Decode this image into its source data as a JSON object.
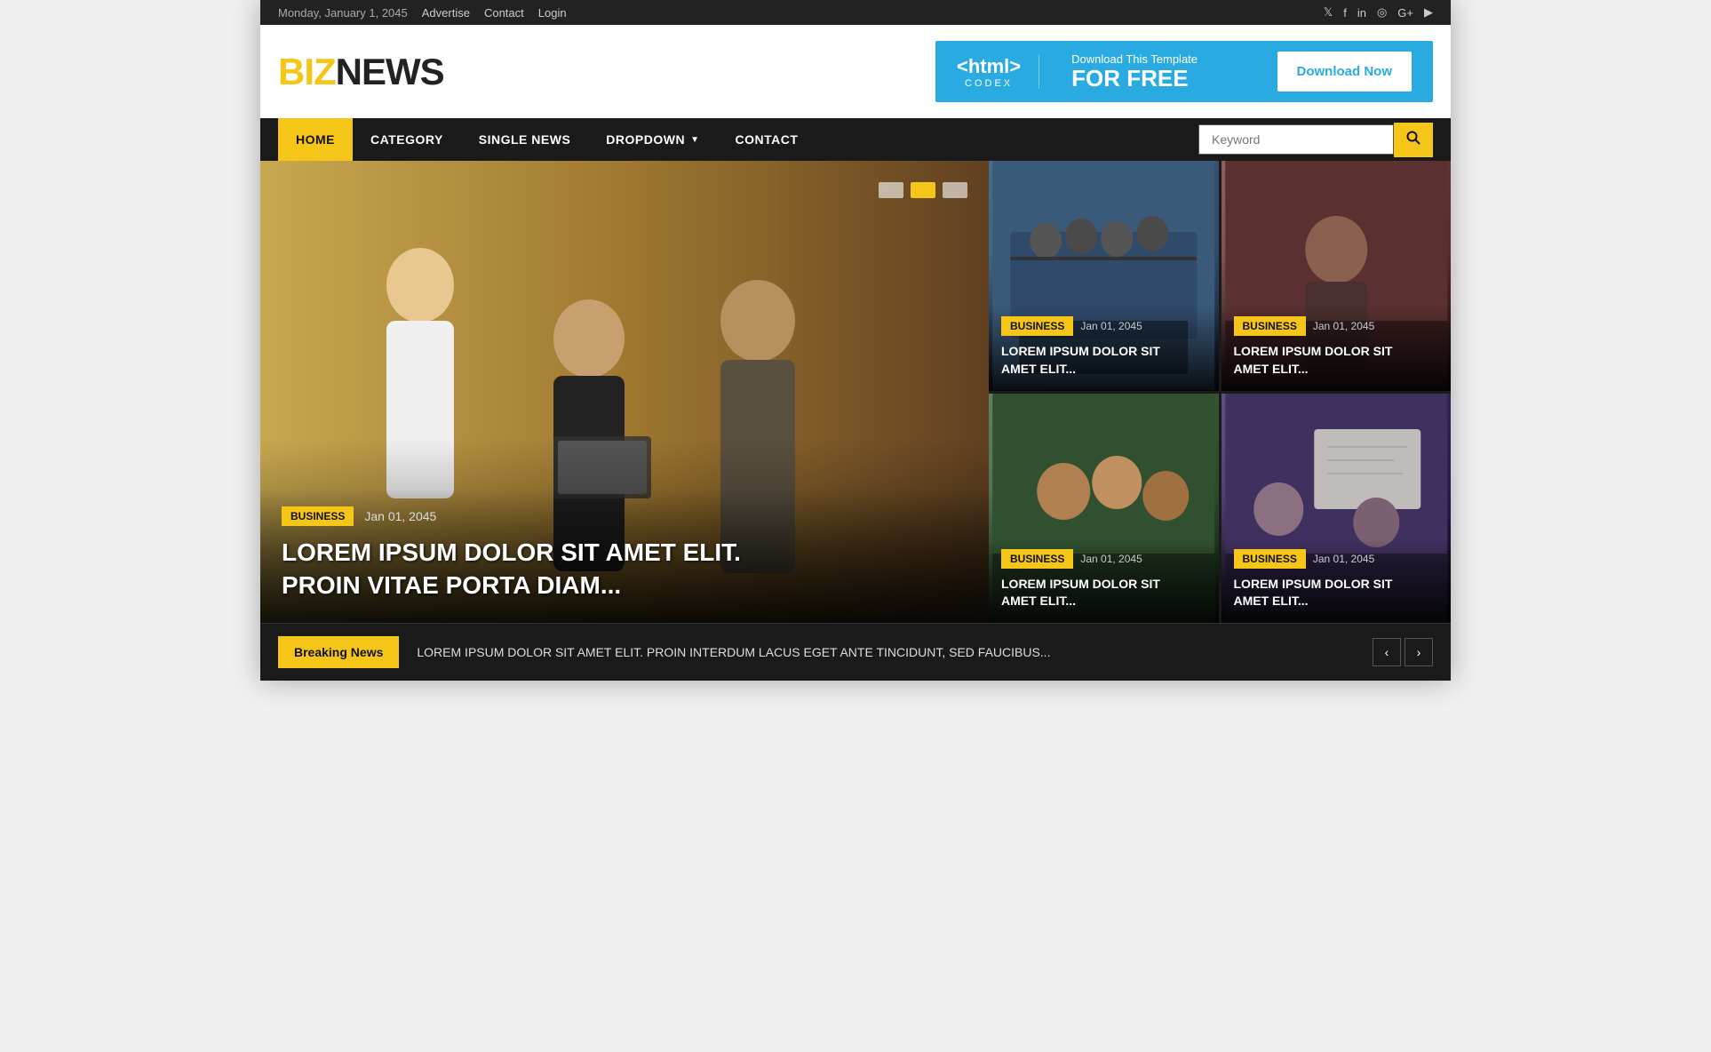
{
  "topbar": {
    "date": "Monday, January 1, 2045",
    "links": [
      "Advertise",
      "Contact",
      "Login"
    ],
    "socials": [
      "𝕏",
      "f",
      "in",
      "◎",
      "G+",
      "▶"
    ]
  },
  "logo": {
    "yellow": "BIZ",
    "dark": "NEWS"
  },
  "ad": {
    "html_tag": "<html>",
    "codex": "CODEX",
    "small": "Download This Template",
    "big": "FOR FREE",
    "button": "Download Now"
  },
  "nav": {
    "items": [
      {
        "label": "HOME",
        "active": true
      },
      {
        "label": "CATEGORY",
        "active": false
      },
      {
        "label": "SINGLE NEWS",
        "active": false
      },
      {
        "label": "DROPDOWN",
        "active": false,
        "has_arrow": true
      },
      {
        "label": "CONTACT",
        "active": false
      }
    ],
    "search_placeholder": "Keyword"
  },
  "hero": {
    "category": "BUSINESS",
    "date": "Jan 01, 2045",
    "title": "LOREM IPSUM DOLOR SIT AMET ELIT.\nPROIN VITAE PORTA DIAM...",
    "dots": [
      "inactive",
      "active",
      "inactive"
    ]
  },
  "side_news": [
    {
      "category": "BUSINESS",
      "date": "Jan 01, 2045",
      "title": "LOREM IPSUM DOLOR SIT\nAMET ELIT..."
    },
    {
      "category": "BUSINESS",
      "date": "Jan 01, 2045",
      "title": "LOREM IPSUM DOLOR SIT\nAMET ELIT..."
    },
    {
      "category": "BUSINESS",
      "date": "Jan 01, 2045",
      "title": "LOREM IPSUM DOLOR SIT\nAMET ELIT..."
    },
    {
      "category": "BUSINESS",
      "date": "Jan 01, 2045",
      "title": "LOREM IPSUM DOLOR SIT\nAMET ELIT..."
    }
  ],
  "breaking_news": {
    "label": "Breaking News",
    "text": "LOREM IPSUM DOLOR SIT AMET ELIT. PROIN INTERDUM LACUS EGET ANTE TINCIDUNT, SED FAUCIBUS...",
    "prev": "‹",
    "next": "›"
  }
}
